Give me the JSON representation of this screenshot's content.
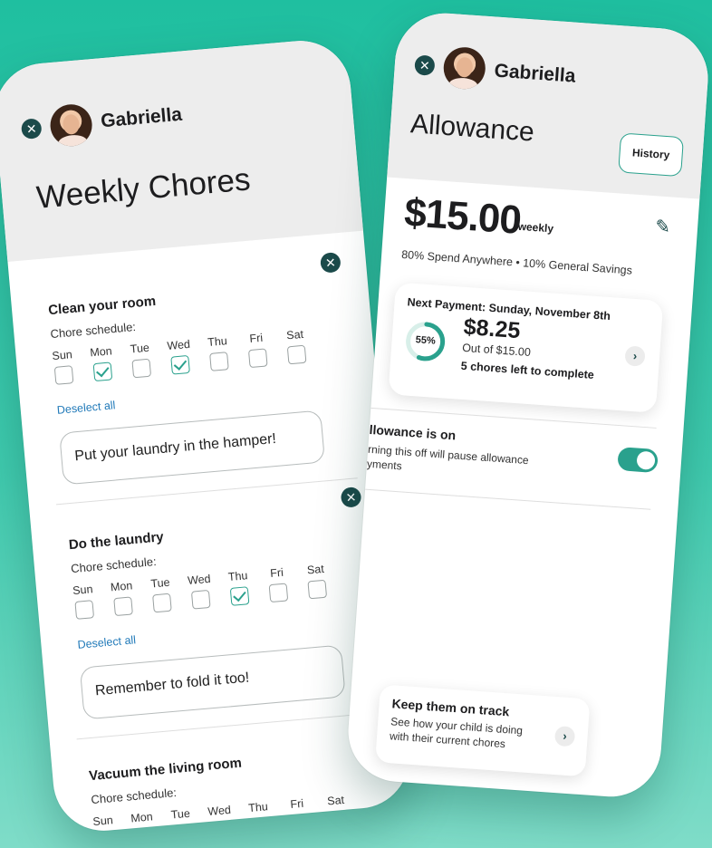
{
  "left": {
    "user_name": "Gabriella",
    "title": "Weekly Chores",
    "schedule_label": "Chore schedule:",
    "deselect_label": "Deselect all",
    "day_labels": [
      "Sun",
      "Mon",
      "Tue",
      "Wed",
      "Thu",
      "Fri",
      "Sat"
    ],
    "chores": [
      {
        "title": "Clean your room",
        "checked": [
          false,
          true,
          false,
          true,
          false,
          false,
          false
        ],
        "note": "Put your laundry in the hamper!"
      },
      {
        "title": "Do the laundry",
        "checked": [
          false,
          false,
          false,
          false,
          true,
          false,
          false
        ],
        "note": "Remember to fold it too!"
      },
      {
        "title": "Vacuum the living room",
        "checked": [
          true,
          false,
          false,
          false,
          false,
          false,
          false
        ],
        "note": ""
      }
    ]
  },
  "right": {
    "user_name": "Gabriella",
    "title": "Allowance",
    "history_label": "History",
    "amount": "$15.00",
    "amount_period": "weekly",
    "split": "80% Spend Anywhere • 10% General Savings",
    "payment": {
      "title": "Next Payment: Sunday, November 8th",
      "percent_label": "55%",
      "percent": 55,
      "amount": "$8.25",
      "out_of": "Out of $15.00",
      "chores_left": "5 chores left to complete"
    },
    "toggle": {
      "title": "llowance is on",
      "desc": "rning this off will pause allowance yments",
      "on": true
    },
    "track": {
      "title": "Keep them on track",
      "desc": "See how your child is doing with their current chores"
    }
  },
  "colors": {
    "accent": "#2aa18d",
    "dark": "#1b4a4a",
    "link": "#1e78b8"
  }
}
